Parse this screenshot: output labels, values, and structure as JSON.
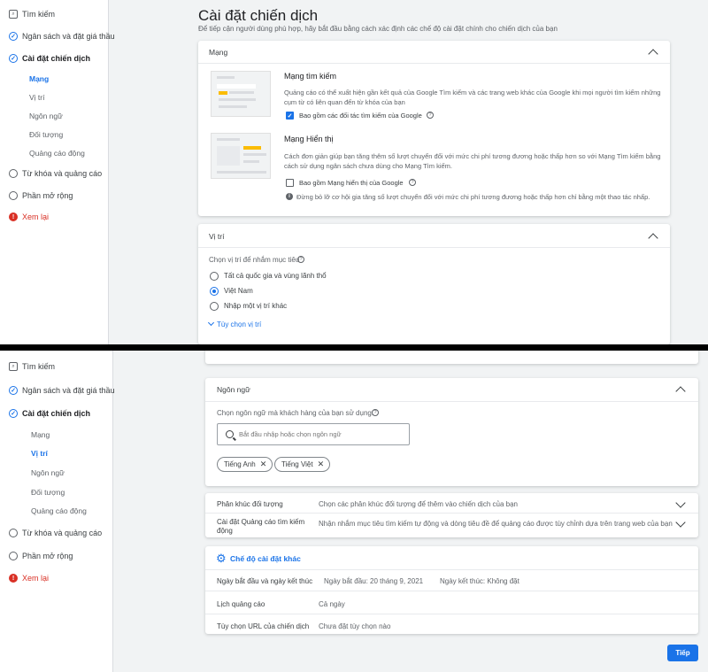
{
  "sidebar": {
    "search": "Tìm kiếm",
    "budget": "Ngân sách và đặt giá thầu",
    "campaign_settings": "Cài đặt chiến dịch",
    "sub_items": [
      "Mạng",
      "Vị trí",
      "Ngôn ngữ",
      "Đối tượng",
      "Quảng cáo động"
    ],
    "keywords": "Từ khóa và quảng cáo",
    "extensions": "Phần mở rộng",
    "review": "Xem lại"
  },
  "page": {
    "title": "Cài đặt chiến dịch",
    "subtitle": "Để tiếp cận người dùng phù hợp, hãy bắt đầu bằng cách xác định các chế độ cài đặt chính cho chiến dịch của bạn"
  },
  "network_card": {
    "header": "Mạng",
    "search_title": "Mạng tìm kiếm",
    "search_desc": "Quảng cáo có thể xuất hiện gần kết quả của Google Tìm kiếm và các trang web khác của Google khi mọi người tìm kiếm những cụm từ có liên quan đến từ khóa của bạn",
    "search_checkbox": "Bao gồm các đối tác tìm kiếm của Google",
    "display_title": "Mạng Hiển thị",
    "display_desc": "Cách đơn giản giúp bạn tăng thêm số lượt chuyển đổi với mức chi phí tương đương hoặc thấp hơn so với Mạng Tìm kiếm bằng cách sử dụng ngân sách chưa dùng cho Mạng Tìm kiếm.",
    "display_checkbox": "Bao gồm Mạng hiển thị của Google",
    "display_note": "Đừng bỏ lỡ cơ hội gia tăng số lượt chuyển đổi với mức chi phí tương đương hoặc thấp hơn chỉ bằng một thao tác nhấp."
  },
  "location_card": {
    "header": "Vị trí",
    "prompt": "Chọn vị trí để nhắm mục tiêu",
    "options": [
      "Tất cả quốc gia và vùng lãnh thổ",
      "Việt Nam",
      "Nhập một vị trí khác"
    ],
    "selected_index": 1,
    "more_link": "Tùy chọn vị trí"
  },
  "language_card": {
    "header": "Ngôn ngữ",
    "prompt": "Chọn ngôn ngữ mà khách hàng của bạn sử dụng.",
    "placeholder": "Bắt đầu nhập hoặc chọn ngôn ngữ",
    "chips": [
      "Tiếng Anh",
      "Tiếng Việt"
    ]
  },
  "audience_row": {
    "label": "Phân khúc đối tượng",
    "value": "Chọn các phân khúc đối tượng để thêm vào chiến dịch của bạn"
  },
  "dsa_row": {
    "label_line1": "Cài đặt Quảng cáo tìm kiếm",
    "label_line2": "động",
    "value": "Nhận nhắm mục tiêu tìm kiếm tự động và dòng tiêu đề để quảng cáo được tùy chỉnh dựa trên trang web của bạn"
  },
  "more_settings": {
    "title": "Chế độ cài đặt khác",
    "dates_label": "Ngày bắt đầu và ngày kết thúc",
    "start_date": "Ngày bắt đầu: 20 tháng 9, 2021",
    "end_date": "Ngày kết thúc: Không đặt",
    "schedule_label": "Lịch quảng cáo",
    "schedule_value": "Cả ngày",
    "url_label": "Tùy chọn URL của chiến dịch",
    "url_value": "Chưa đặt tùy chọn nào"
  },
  "buttons": {
    "next": "Tiếp"
  },
  "colors": {
    "accent": "#1a73e8",
    "error": "#d93025",
    "highlight": "#fbbc04"
  }
}
